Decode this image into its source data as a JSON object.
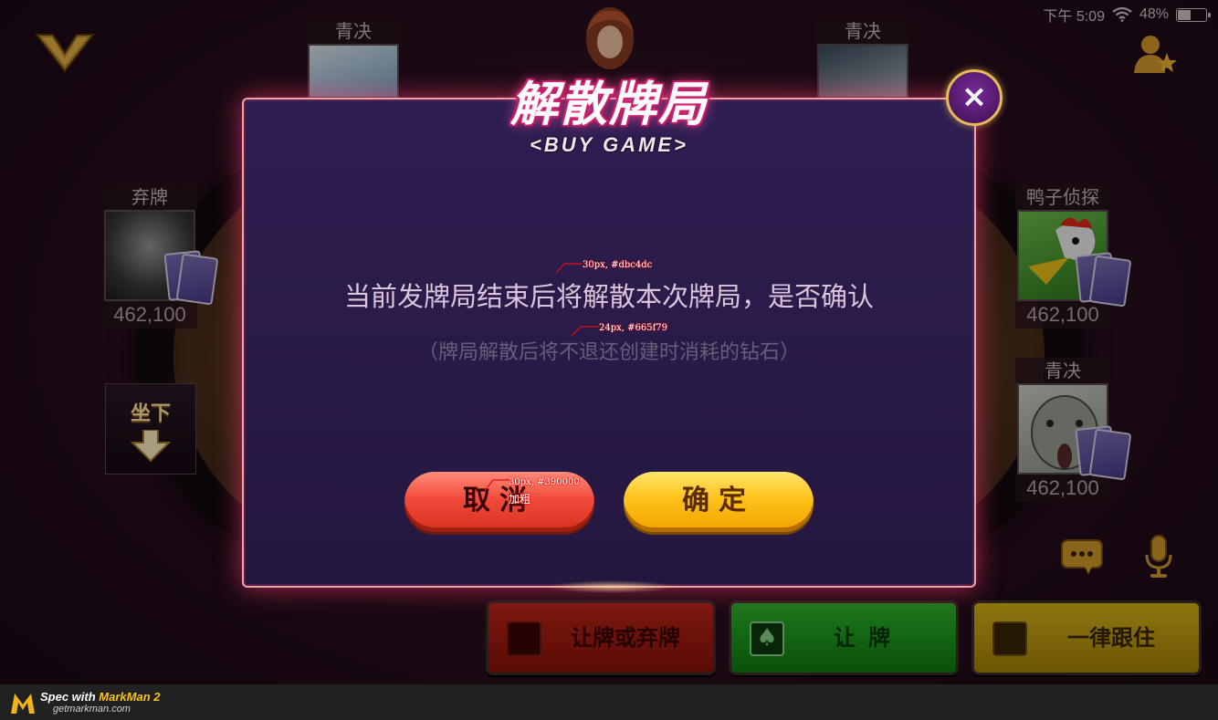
{
  "status_bar": {
    "time": "下午 5:09",
    "battery_percent": "48%",
    "battery_level": 0.48
  },
  "seats": [
    {
      "name": "青决",
      "score": ""
    },
    {
      "name": "青决",
      "score": ""
    },
    {
      "name": "弃牌",
      "score": "462,100"
    },
    {
      "name": "鸭子侦探",
      "score": "462,100"
    },
    {
      "name": "青决",
      "score": "462,100"
    }
  ],
  "sit_down": {
    "label": "坐下"
  },
  "modal": {
    "title": "解散牌局",
    "subtitle": "<BUY GAME>",
    "close_label": "×",
    "message": "当前发牌局结束后将解散本次牌局，是否确认",
    "note": "（牌局解散后将不退还创建时消耗的钻石）",
    "cancel_label": "取消",
    "confirm_label": "确定"
  },
  "annotations": {
    "message_spec": "30px, #dbc4dc",
    "note_spec": "24px, #665f79",
    "cancel_spec": "30px, #390000",
    "cancel_note": "加粗"
  },
  "actions": [
    {
      "label": "让牌或弃牌",
      "color": "#c0261a"
    },
    {
      "label": "让牌",
      "color": "#2dbb2d",
      "icon": "spade-icon"
    },
    {
      "label": "一律跟住",
      "color": "#d8b61a"
    }
  ],
  "footer": {
    "prefix": "Spec with ",
    "brand": "MarkMan 2",
    "url": "getmarkman.com"
  },
  "colors": {
    "modal_bg": "#2f1e52",
    "modal_border": "#f0a3a6",
    "message": "#dbc4dc",
    "note": "#665f79",
    "cancel_text": "#390000"
  }
}
